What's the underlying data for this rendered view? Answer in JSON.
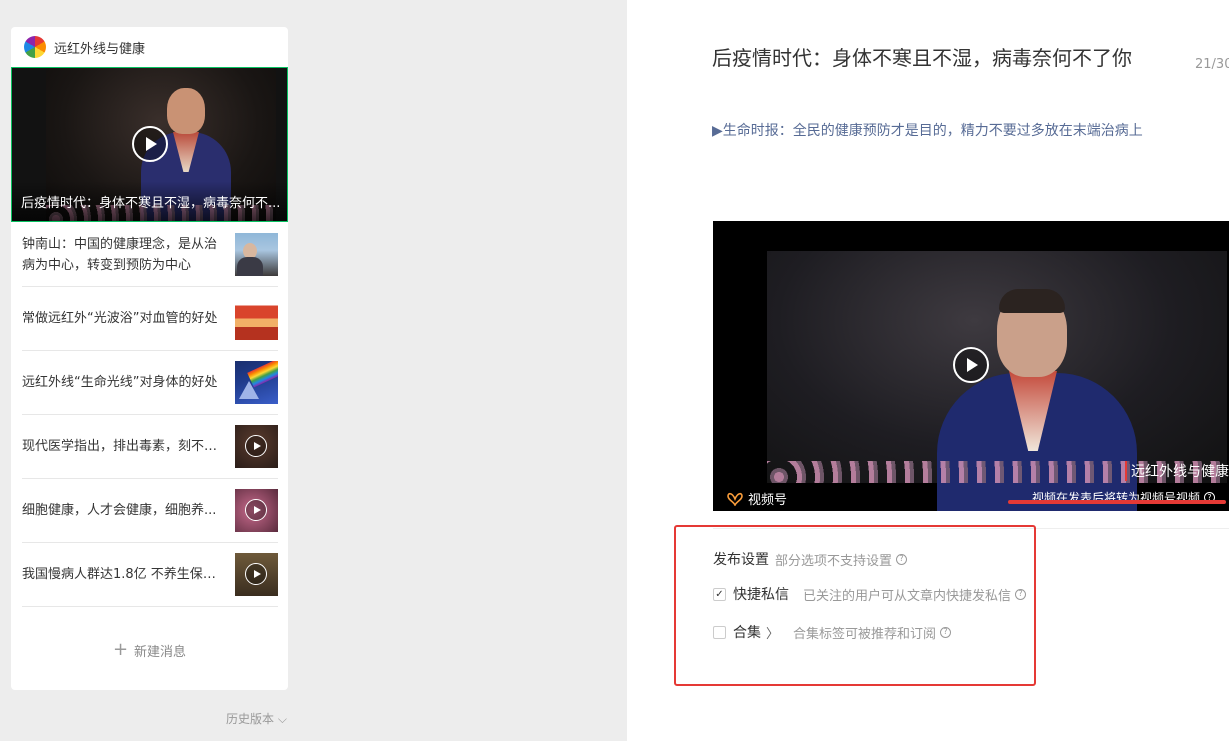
{
  "account": {
    "name": "远红外线与健康"
  },
  "cover_article": {
    "title": "后疫情时代：身体不寒且不湿，病毒奈何不..."
  },
  "articles": [
    {
      "title": "钟南山：中国的健康理念，是从治病为中心，转变到预防为中心",
      "thumb": "speaker-photo",
      "video": false
    },
    {
      "title": "常做远红外“光波浴”对血管的好处",
      "thumb": "sauna-photo",
      "video": false
    },
    {
      "title": "远红外线“生命光线”对身体的好处",
      "thumb": "prism-rainbow",
      "video": false
    },
    {
      "title": "现代医学指出，排出毒素，刻不容...",
      "thumb": "video-thumb",
      "video": true
    },
    {
      "title": "细胞健康，人才会健康，细胞养...",
      "thumb": "video-thumb",
      "video": true
    },
    {
      "title": "我国慢病人群达1.8亿 不养生保健...",
      "thumb": "video-thumb",
      "video": true
    }
  ],
  "new_message": {
    "label": "新建消息"
  },
  "history": {
    "label": "历史版本"
  },
  "editor": {
    "title": "后疫情时代：身体不寒且不湿，病毒奈何不了你",
    "title_count": "21/30",
    "digest": "▶生命时报：全民的健康预防才是目的，精力不要过多放在末端治病上",
    "video": {
      "watermark": "远红外线与健康",
      "channel_label": "视频号",
      "note": "视频在发表后将转为视频号视频"
    },
    "settings": {
      "title": "发布设置",
      "subtitle": "部分选项不支持设置",
      "quick_dm": {
        "label": "快捷私信",
        "desc": "已关注的用户可从文章内快捷发私信",
        "checked": true
      },
      "collection": {
        "label": "合集",
        "desc": "合集标签可被推荐和订阅",
        "checked": false
      }
    }
  },
  "colors": {
    "accent_green": "#07c160",
    "link_blue": "#576b95",
    "highlight_red": "#e53935"
  }
}
